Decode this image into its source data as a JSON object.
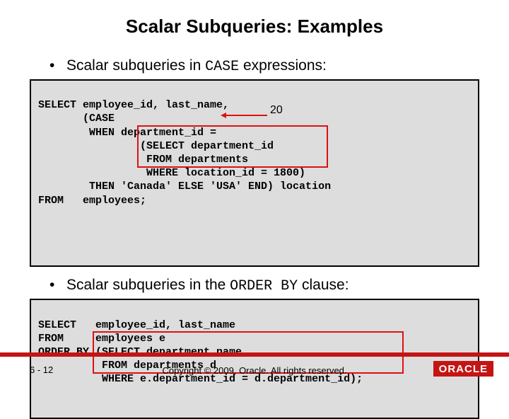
{
  "title": "Scalar Subqueries: Examples",
  "bullet1": {
    "dot": "•",
    "pre": "Scalar subqueries in ",
    "mono": "CASE",
    "post": " expressions:"
  },
  "code1": {
    "l0": "SELECT employee_id, last_name,",
    "l1": "       (CASE",
    "l2": "        WHEN department_id =",
    "l3": "                (SELECT department_id",
    "l4": "                 FROM departments",
    "l5": "                 WHERE location_id = 1800)",
    "l6": "        THEN 'Canada' ELSE 'USA' END) location",
    "l7": "FROM   employees;"
  },
  "annotation": {
    "value": "20"
  },
  "bullet2": {
    "dot": "•",
    "pre": "Scalar subqueries in the ",
    "mono": "ORDER BY",
    "post": " clause:"
  },
  "code2": {
    "l0": "SELECT   employee_id, last_name",
    "l1": "FROM     employees e",
    "l2": "ORDER BY (SELECT department_name",
    "l3": "          FROM departments d",
    "l4": "          WHERE e.department_id = d.department_id);"
  },
  "footer": {
    "page": "6 - 12",
    "copyright": "Copyright © 2009, Oracle. All rights reserved.",
    "brand": "ORACLE"
  }
}
